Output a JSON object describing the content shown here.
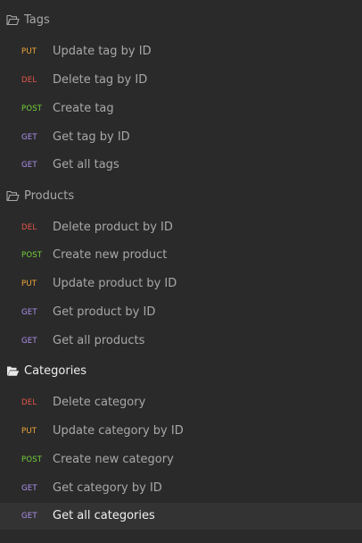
{
  "folders": [
    {
      "name": "Tags",
      "state": "collapsed-style",
      "requests": [
        {
          "method": "PUT",
          "label": "Update tag by ID"
        },
        {
          "method": "DEL",
          "label": "Delete tag by ID"
        },
        {
          "method": "POST",
          "label": "Create tag"
        },
        {
          "method": "GET",
          "label": "Get tag by ID"
        },
        {
          "method": "GET",
          "label": "Get all tags"
        }
      ]
    },
    {
      "name": "Products",
      "state": "collapsed-style",
      "requests": [
        {
          "method": "DEL",
          "label": "Delete product by ID"
        },
        {
          "method": "POST",
          "label": "Create new product"
        },
        {
          "method": "PUT",
          "label": "Update product by ID"
        },
        {
          "method": "GET",
          "label": "Get product by ID"
        },
        {
          "method": "GET",
          "label": "Get all products"
        }
      ]
    },
    {
      "name": "Categories",
      "state": "open-active",
      "requests": [
        {
          "method": "DEL",
          "label": "Delete category"
        },
        {
          "method": "PUT",
          "label": "Update category by ID"
        },
        {
          "method": "POST",
          "label": "Create new category"
        },
        {
          "method": "GET",
          "label": "Get category by ID"
        },
        {
          "method": "GET",
          "label": "Get all categories",
          "selected": true
        }
      ]
    }
  ],
  "colors": {
    "background": "#2a2a2a",
    "selected_row": "#333333",
    "PUT": "#f2a93b",
    "DEL": "#e7574a",
    "POST": "#74d13a",
    "GET": "#b093f0"
  },
  "icons": {
    "folder": "open-folder-icon"
  }
}
